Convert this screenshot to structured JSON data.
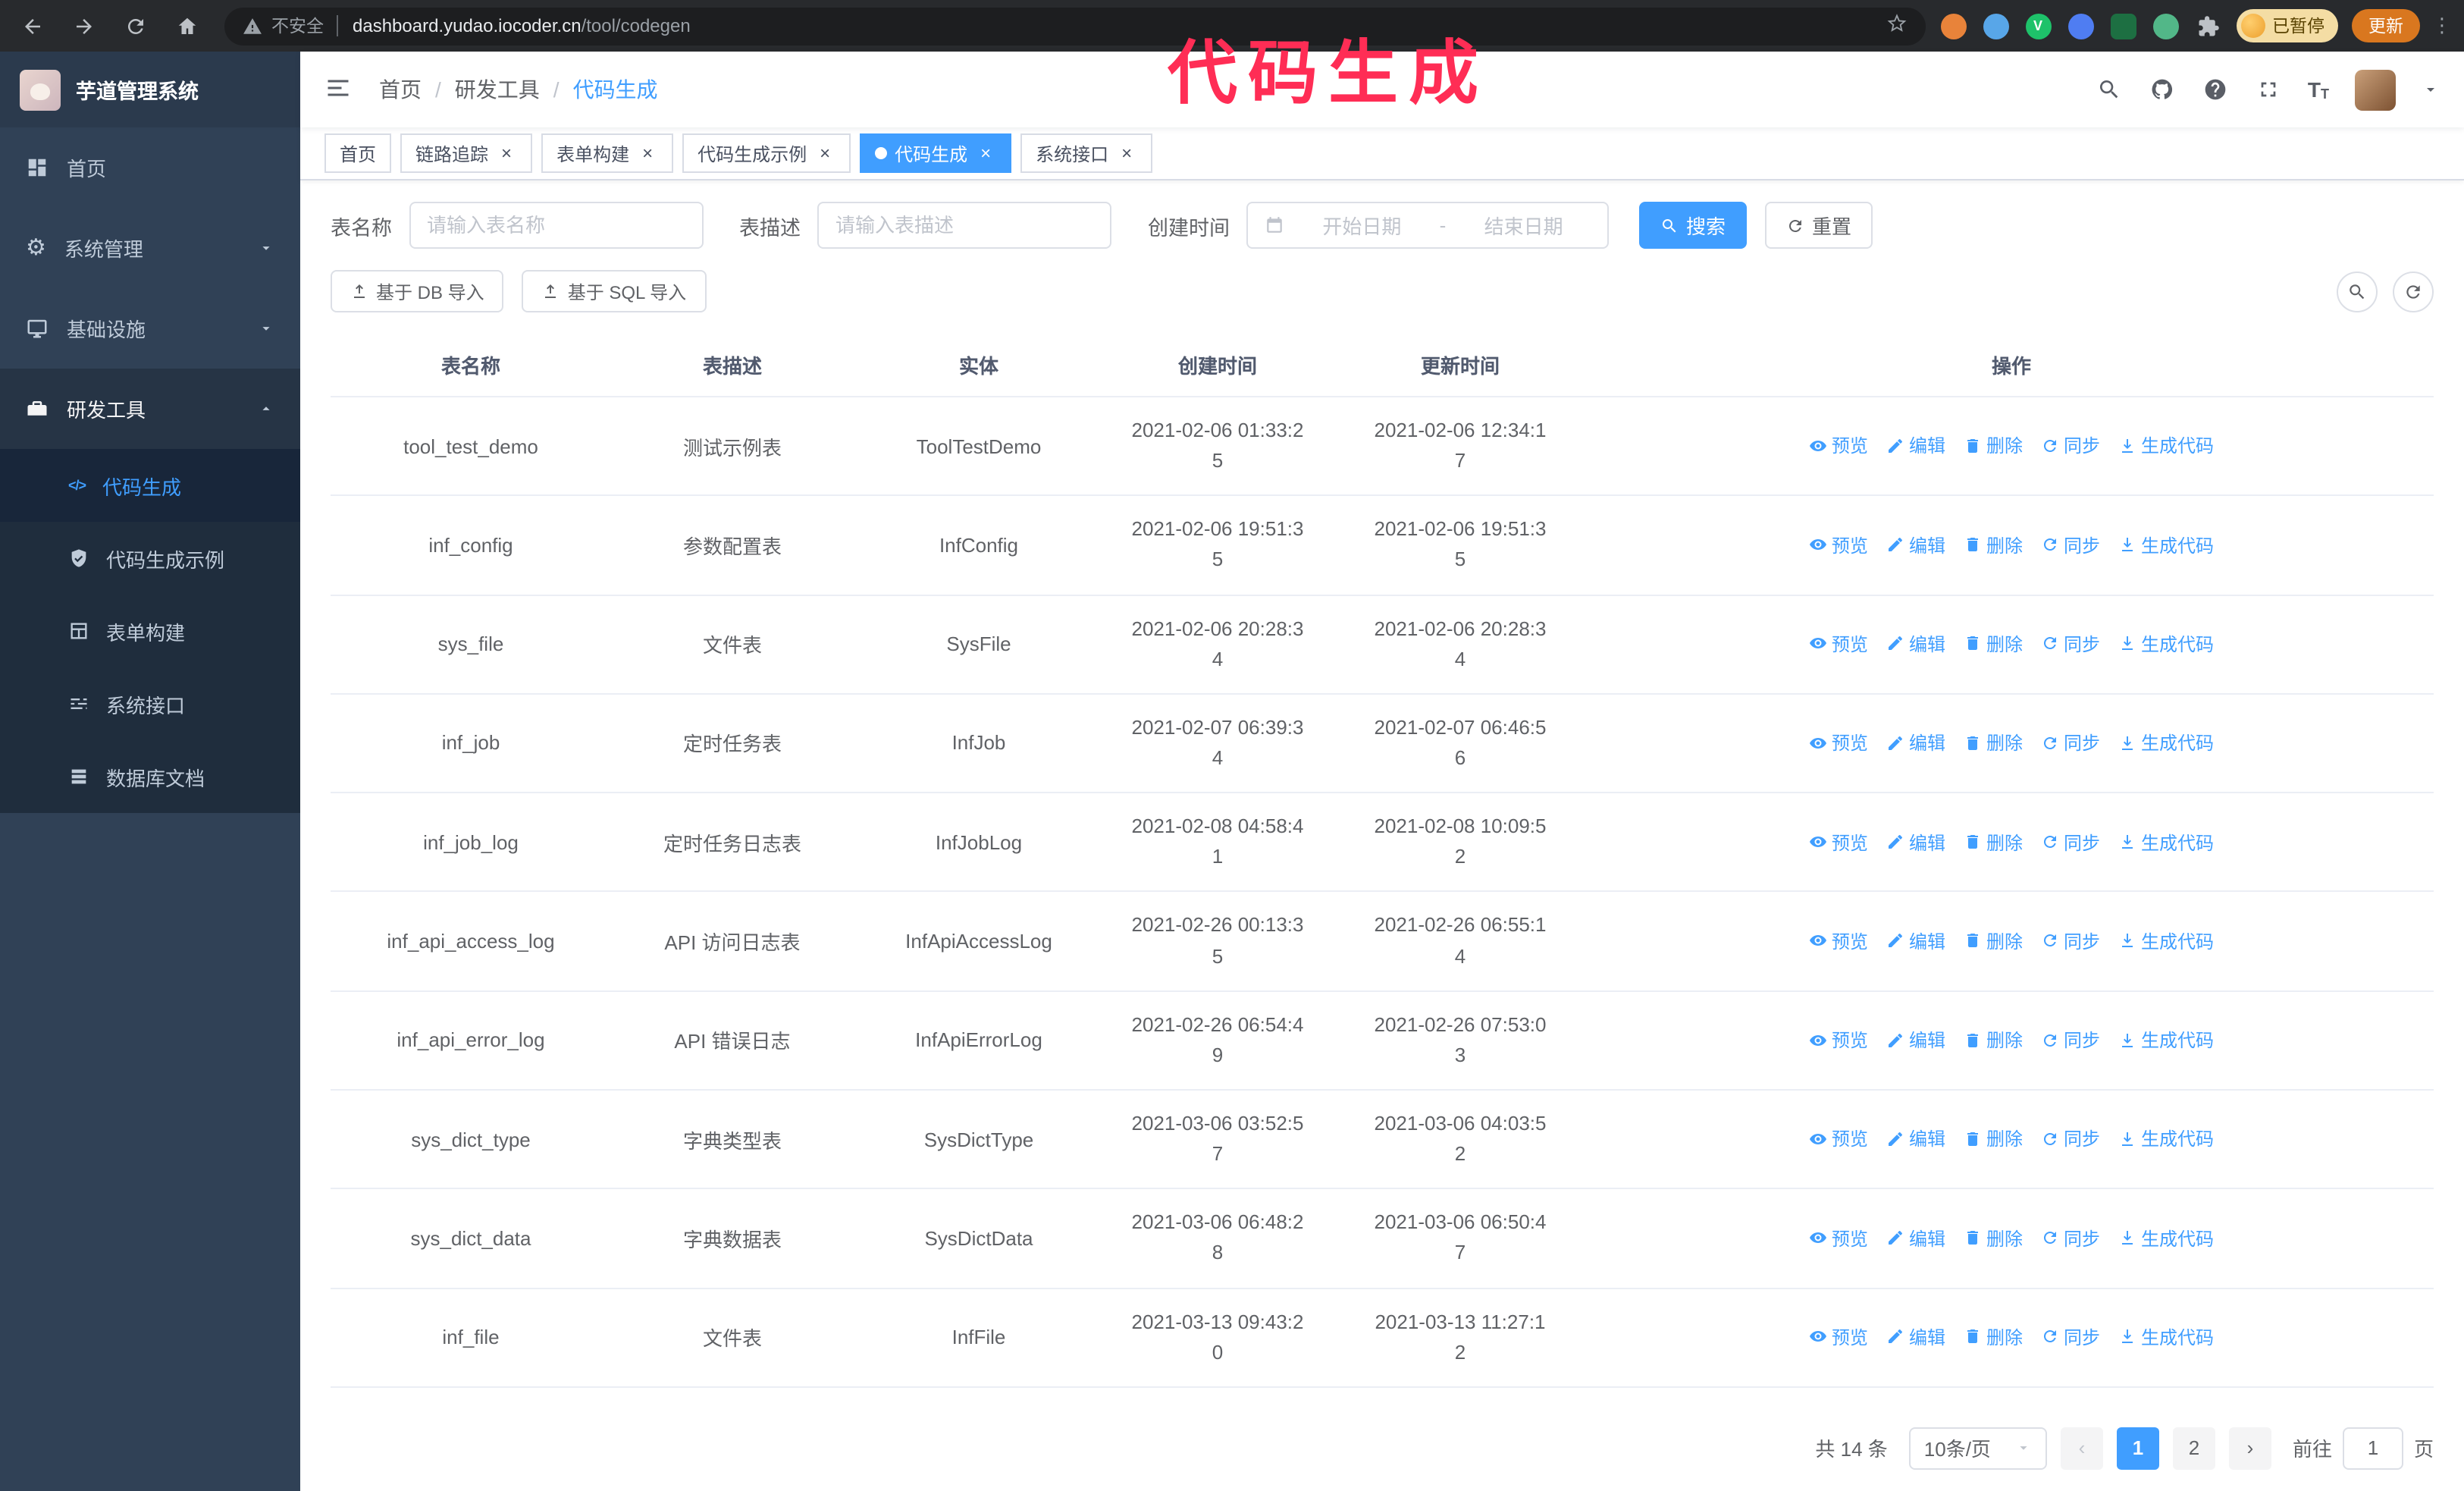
{
  "annotation": {
    "text": "代码生成"
  },
  "browser": {
    "security_label": "不安全",
    "url_host": "dashboard.yudao.iocoder.cn",
    "url_path": "/tool/codegen",
    "profile_badge": "已暂停",
    "update_button": "更新"
  },
  "sidebar": {
    "logo_title": "芋道管理系统",
    "menu": [
      {
        "label": "首页"
      },
      {
        "label": "系统管理"
      },
      {
        "label": "基础设施"
      },
      {
        "label": "研发工具"
      }
    ],
    "submenu": [
      {
        "label": "代码生成"
      },
      {
        "label": "代码生成示例"
      },
      {
        "label": "表单构建"
      },
      {
        "label": "系统接口"
      },
      {
        "label": "数据库文档"
      }
    ]
  },
  "navbar": {
    "breadcrumb": {
      "home": "首页",
      "parent": "研发工具",
      "current": "代码生成"
    }
  },
  "tabs": [
    {
      "label": "首页"
    },
    {
      "label": "链路追踪"
    },
    {
      "label": "表单构建"
    },
    {
      "label": "代码生成示例"
    },
    {
      "label": "代码生成"
    },
    {
      "label": "系统接口"
    }
  ],
  "filters": {
    "table_name_label": "表名称",
    "table_name_placeholder": "请输入表名称",
    "table_desc_label": "表描述",
    "table_desc_placeholder": "请输入表描述",
    "create_time_label": "创建时间",
    "date_start_placeholder": "开始日期",
    "date_separator": "-",
    "date_end_placeholder": "结束日期",
    "search_button": "搜索",
    "reset_button": "重置"
  },
  "toolbar": {
    "import_db_button": "基于 DB 导入",
    "import_sql_button": "基于 SQL 导入"
  },
  "table": {
    "columns": [
      "表名称",
      "表描述",
      "实体",
      "创建时间",
      "更新时间",
      "操作"
    ],
    "actions": [
      "预览",
      "编辑",
      "删除",
      "同步",
      "生成代码"
    ],
    "rows": [
      {
        "name": "tool_test_demo",
        "desc": "测试示例表",
        "entity": "ToolTestDemo",
        "created": "2021-02-06 01:33:25",
        "updated": "2021-02-06 12:34:17"
      },
      {
        "name": "inf_config",
        "desc": "参数配置表",
        "entity": "InfConfig",
        "created": "2021-02-06 19:51:35",
        "updated": "2021-02-06 19:51:35"
      },
      {
        "name": "sys_file",
        "desc": "文件表",
        "entity": "SysFile",
        "created": "2021-02-06 20:28:34",
        "updated": "2021-02-06 20:28:34"
      },
      {
        "name": "inf_job",
        "desc": "定时任务表",
        "entity": "InfJob",
        "created": "2021-02-07 06:39:34",
        "updated": "2021-02-07 06:46:56"
      },
      {
        "name": "inf_job_log",
        "desc": "定时任务日志表",
        "entity": "InfJobLog",
        "created": "2021-02-08 04:58:41",
        "updated": "2021-02-08 10:09:52"
      },
      {
        "name": "inf_api_access_log",
        "desc": "API 访问日志表",
        "entity": "InfApiAccessLog",
        "created": "2021-02-26 00:13:35",
        "updated": "2021-02-26 06:55:14"
      },
      {
        "name": "inf_api_error_log",
        "desc": "API 错误日志",
        "entity": "InfApiErrorLog",
        "created": "2021-02-26 06:54:49",
        "updated": "2021-02-26 07:53:03"
      },
      {
        "name": "sys_dict_type",
        "desc": "字典类型表",
        "entity": "SysDictType",
        "created": "2021-03-06 03:52:57",
        "updated": "2021-03-06 04:03:52"
      },
      {
        "name": "sys_dict_data",
        "desc": "字典数据表",
        "entity": "SysDictData",
        "created": "2021-03-06 06:48:28",
        "updated": "2021-03-06 06:50:47"
      },
      {
        "name": "inf_file",
        "desc": "文件表",
        "entity": "InfFile",
        "created": "2021-03-13 09:43:20",
        "updated": "2021-03-13 11:27:12"
      }
    ]
  },
  "pagination": {
    "total_text": "共 14 条",
    "page_size": "10条/页",
    "prev": "‹",
    "page_1": "1",
    "page_2": "2",
    "next": "›",
    "goto_label": "前往",
    "goto_value": "1",
    "goto_suffix": "页"
  }
}
